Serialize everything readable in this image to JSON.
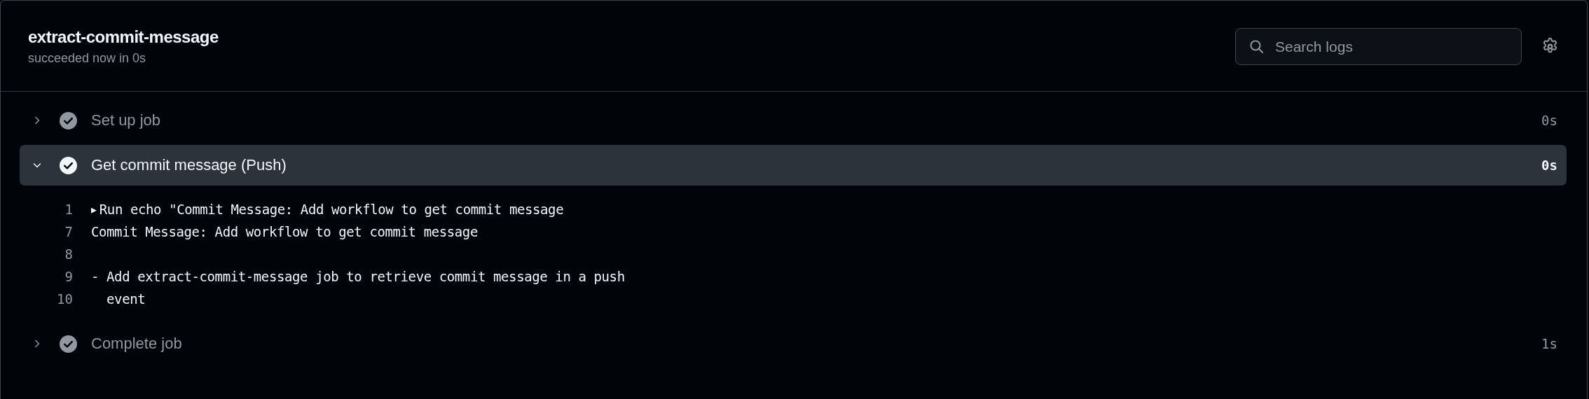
{
  "job": {
    "title": "extract-commit-message",
    "subtitle": "succeeded now in 0s"
  },
  "search": {
    "placeholder": "Search logs"
  },
  "steps": [
    {
      "name": "Set up job",
      "time": "0s",
      "expanded": false
    },
    {
      "name": "Get commit message (Push)",
      "time": "0s",
      "expanded": true,
      "log": [
        {
          "number": "1",
          "marker": "▶",
          "text": "Run echo \"Commit Message: Add workflow to get commit message"
        },
        {
          "number": "7",
          "text": "Commit Message: Add workflow to get commit message"
        },
        {
          "number": "8"
        },
        {
          "number": "9",
          "text": "- Add extract-commit-message job to retrieve commit message in a push"
        },
        {
          "number": "10",
          "text": "  event"
        }
      ]
    },
    {
      "name": "Complete job",
      "time": "1s",
      "expanded": false
    }
  ]
}
